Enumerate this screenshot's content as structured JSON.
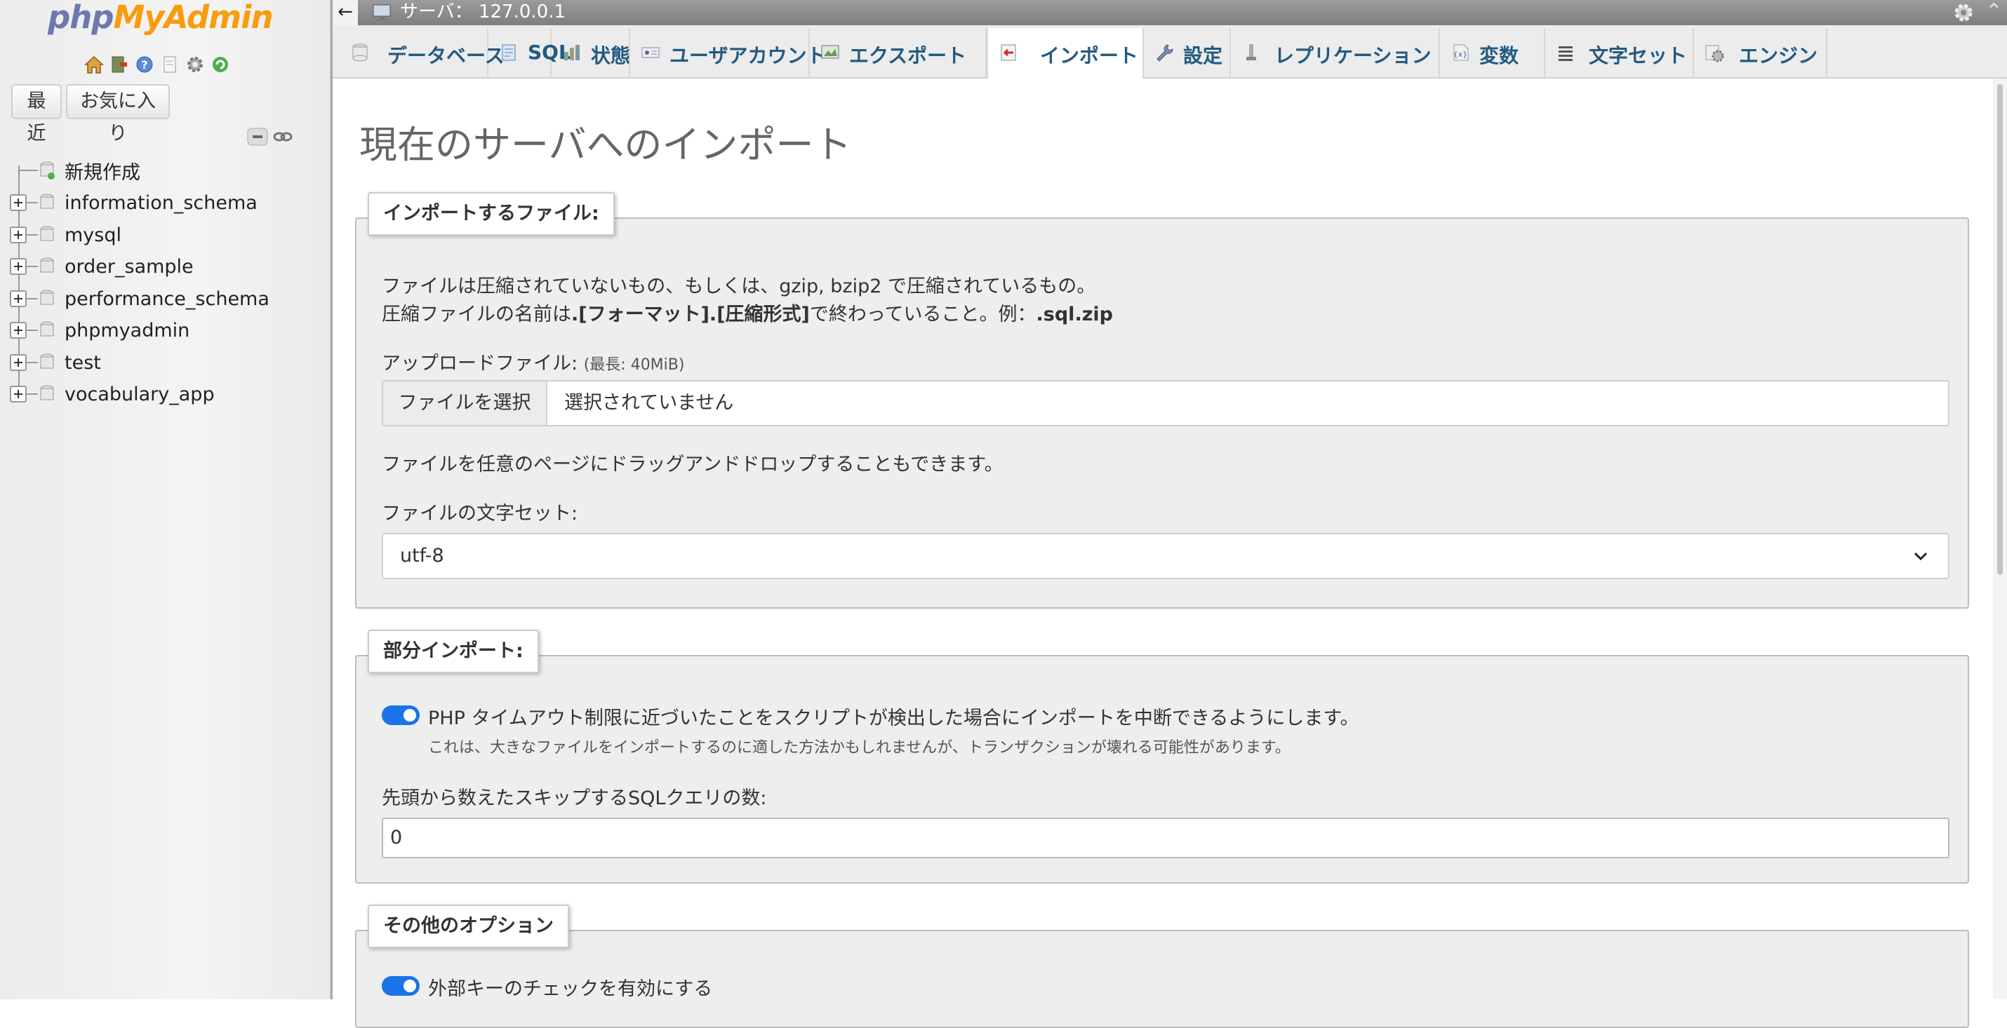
{
  "sidebar": {
    "logo_part1": "php",
    "logo_part2": "MyAdmin",
    "quick_icons": [
      "home-icon",
      "logout-icon",
      "help-icon",
      "docs-icon",
      "settings-icon",
      "reload-icon"
    ],
    "recent_button": "最近",
    "favorites_button": "お気に入り",
    "tree": [
      {
        "label": "新規作成",
        "type": "new"
      },
      {
        "label": "information_schema",
        "type": "db"
      },
      {
        "label": "mysql",
        "type": "db"
      },
      {
        "label": "order_sample",
        "type": "db"
      },
      {
        "label": "performance_schema",
        "type": "db"
      },
      {
        "label": "phpmyadmin",
        "type": "db"
      },
      {
        "label": "test",
        "type": "db"
      },
      {
        "label": "vocabulary_app",
        "type": "db"
      }
    ]
  },
  "topbar": {
    "back_icon": "←",
    "server_label": "サーバ： 127.0.0.1",
    "close_icon": "⌃"
  },
  "tabs": [
    {
      "label": "データベース",
      "icon": "database-icon"
    },
    {
      "label": "SQL",
      "icon": "sql-icon"
    },
    {
      "label": "状態",
      "icon": "status-icon"
    },
    {
      "label": "ユーザアカウント",
      "icon": "users-icon"
    },
    {
      "label": "エクスポート",
      "icon": "export-icon"
    },
    {
      "label": "インポート",
      "icon": "import-icon",
      "active": true
    },
    {
      "label": "設定",
      "icon": "wrench-icon"
    },
    {
      "label": "レプリケーション",
      "icon": "replication-icon"
    },
    {
      "label": "変数",
      "icon": "variables-icon"
    },
    {
      "label": "文字セット",
      "icon": "charset-icon"
    },
    {
      "label": "エンジン",
      "icon": "engine-icon"
    }
  ],
  "main": {
    "title": "現在のサーバへのインポート",
    "file_section": {
      "legend": "インポートするファイル:",
      "desc_line1": "ファイルは圧縮されていないもの、もしくは、gzip, bzip2 で圧縮されているもの。",
      "desc_line2_pre": "圧縮ファイルの名前は",
      "desc_line2_bold1": ".[フォーマット].[圧縮形式]",
      "desc_line2_mid": "で終わっていること。例：",
      "desc_line2_bold2": ".sql.zip",
      "upload_label": "アップロードファイル:",
      "upload_limit": "(最長: 40MiB)",
      "choose_button": "ファイルを選択",
      "no_file": "選択されていません",
      "drag_hint": "ファイルを任意のページにドラッグアンドドロップすることもできます。",
      "charset_label": "ファイルの文字セット:",
      "charset_value": "utf-8"
    },
    "partial_section": {
      "legend": "部分インポート:",
      "toggle_label": "PHP タイムアウト制限に近づいたことをスクリプトが検出した場合にインポートを中断できるようにします。",
      "toggle_on": true,
      "toggle_hint": "これは、大きなファイルをインポートするのに適した方法かもしれませんが、トランザクションが壊れる可能性があります。",
      "skip_label": "先頭から数えたスキップするSQLクエリの数:",
      "skip_value": "0"
    },
    "other_section": {
      "legend": "その他のオプション",
      "fk_label": "外部キーのチェックを有効にする",
      "fk_on": true
    }
  },
  "colors": {
    "accent_blue": "#1a73e8",
    "tab_text": "#235a81",
    "logo_php": "#6c78af",
    "logo_myadmin": "#f89c0e"
  }
}
